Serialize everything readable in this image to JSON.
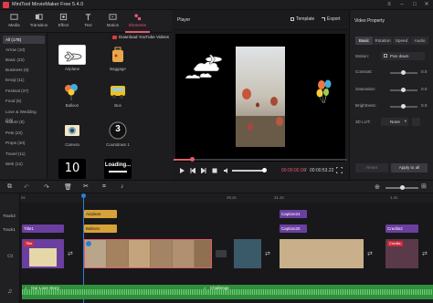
{
  "app": {
    "title": "MiniTool MovieMaker Free 5.4.0"
  },
  "toolbar": {
    "items": [
      "Media",
      "Transition",
      "Effect",
      "Text",
      "Motion",
      "Elements"
    ],
    "active": "Elements"
  },
  "library": {
    "download_label": "Download YouTube Videos",
    "categories": [
      "All (178)",
      "Arrow (10)",
      "Basic (22)",
      "Business (6)",
      "Emoji (11)",
      "Festival (37)",
      "Food (6)",
      "Love & Wedding (16)",
      "Nature (5)",
      "Pets (23)",
      "Props (20)",
      "Travel (11)",
      "Web (12)"
    ],
    "items": [
      "Airplane",
      "Baggage",
      "Balloon",
      "Bus",
      "Camera",
      "Countdown 1",
      "",
      ""
    ],
    "countdown_text": "3",
    "number_text": "10",
    "loading_text": "Loading..."
  },
  "player": {
    "title": "Player",
    "template_label": "Template",
    "export_label": "Export",
    "time": "00:00:00.00",
    "divider": "/",
    "duration": "00:00:53.22"
  },
  "properties": {
    "title": "Video Property",
    "tabs": [
      "Basic",
      "Rotation",
      "Speed",
      "Audio"
    ],
    "rows": [
      {
        "label": "Motion:",
        "value": "Pan down"
      },
      {
        "label": "Contrast:",
        "value": "0.0"
      },
      {
        "label": "Saturation:",
        "value": "0.0"
      },
      {
        "label": "Brightness:",
        "value": "0.0"
      },
      {
        "label": "3D LUT:",
        "value": "None"
      }
    ],
    "reset_label": "Reset",
    "apply_label": "Apply to all"
  },
  "timeline": {
    "ruler": [
      "0s",
      "26.2s",
      "31.2s",
      "1.2s"
    ],
    "tracks": [
      "Track2",
      "Track1"
    ],
    "track2_clips": [
      "Airplane",
      "Caption24"
    ],
    "track1_clips": [
      "Title1",
      "Balloon",
      "Caption25",
      "Credits2"
    ],
    "element_clip": "Balloon",
    "audio_clips": [
      "Our Love Story",
      "Challenge"
    ],
    "clip_badges": [
      "Title",
      "Credits"
    ]
  },
  "colors": {
    "accent": "#e45b6a",
    "title_clip": "#6b3fa0",
    "element_clip": "#d8a23a",
    "audio": "#2f8f3a"
  }
}
